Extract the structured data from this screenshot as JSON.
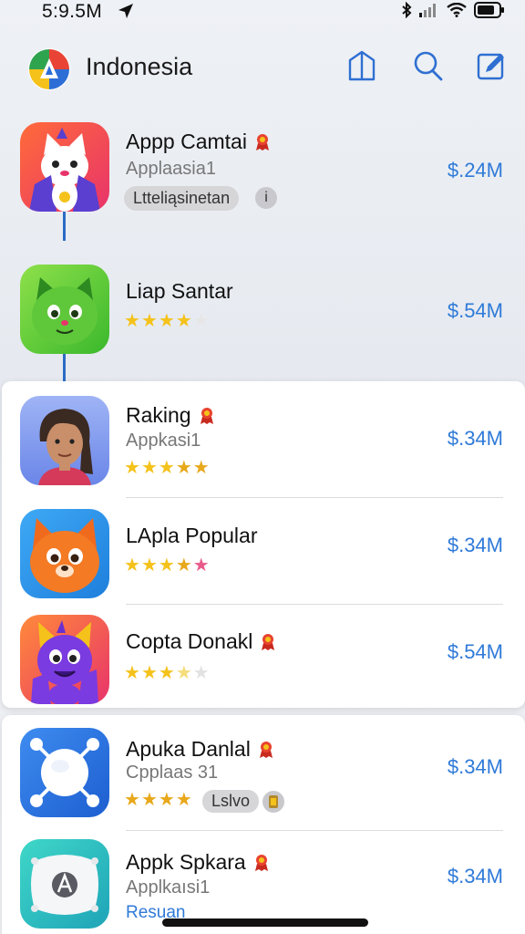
{
  "status": {
    "time": "5:9.5M"
  },
  "header": {
    "title": "Indonesia"
  },
  "colors": {
    "accent": "#2f7ad8",
    "star": "#f4c21b",
    "badge": "#e8432f"
  },
  "apps": [
    {
      "name": "Appp Camtai",
      "subtitle": "Applaasia1",
      "tag": "Ltteliąsinetan",
      "info": "i",
      "price": "$.24M",
      "rating_stars": 0
    },
    {
      "name": "Liap Santar",
      "price": "$.54M",
      "rating_stars": 4
    },
    {
      "name": "Raking",
      "subtitle": "Appkasi1",
      "price": "$.34M",
      "rating_stars": 5
    },
    {
      "name": "LApla Popular",
      "price": "$.34M",
      "rating_stars": 5
    },
    {
      "name": "Copta Donakl",
      "price": "$.54M",
      "rating_stars": 3.5
    },
    {
      "name": "Apuka Danlal",
      "subtitle": "Cpplaas 31",
      "tag": "Lslvo",
      "price": "$.34M",
      "rating_stars": 4
    },
    {
      "name": "Appk Spkara",
      "subtitle": "Applkaısi1",
      "link": "Resuan",
      "price": "$.34M"
    }
  ]
}
